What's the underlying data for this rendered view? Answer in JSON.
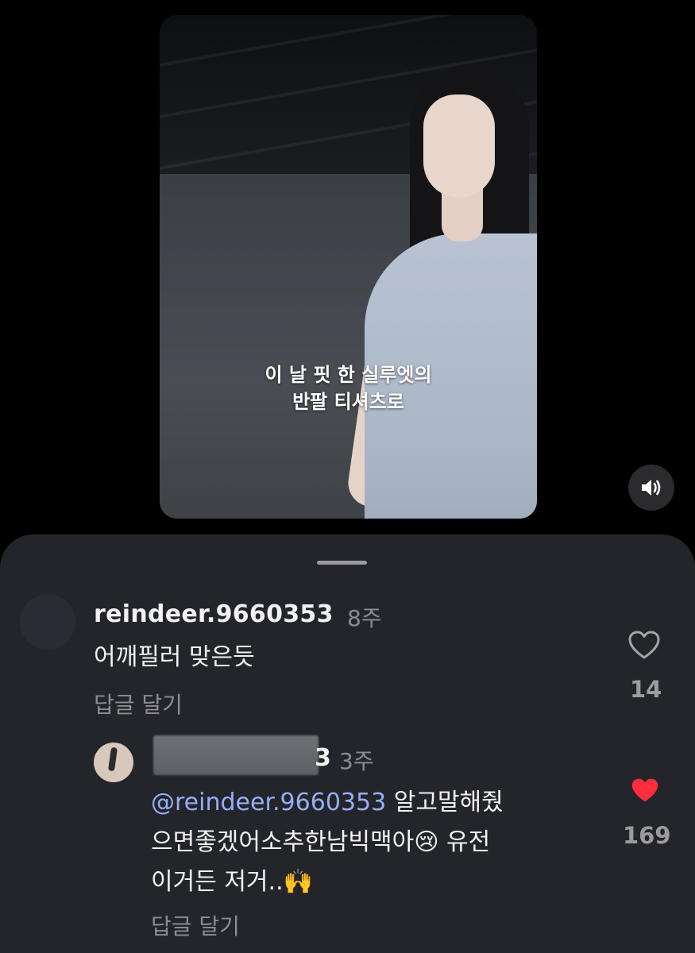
{
  "video": {
    "caption_lines": [
      "이 날 핏 한 실루엣의",
      "반팔 티셔츠로"
    ],
    "mute_icon": "speaker-volume-icon"
  },
  "comments": [
    {
      "username": "reindeer.9660353",
      "time": "8주",
      "text": "어깨필러 맞은듯",
      "reply_label": "답글 달기",
      "likes": "14",
      "liked": false
    },
    {
      "username_visible_tail": "3",
      "time": "3주",
      "mention": "@reindeer.9660353",
      "text_line1": " 알고말해줬",
      "text_line2": "으면좋겠어소추한남빅맥아😢  유전",
      "text_line3": "이거든 저거..🙌",
      "reply_label": "답글 달기",
      "likes": "169",
      "liked": true
    }
  ],
  "colors": {
    "sheet_bg": "#24252a",
    "mention": "#96aef7",
    "heart_liked": "#ff2d3d",
    "secondary_text": "#8d8d93"
  }
}
